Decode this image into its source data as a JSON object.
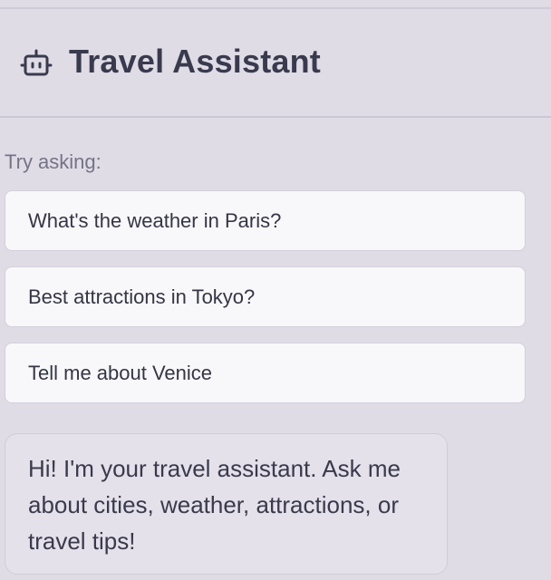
{
  "header": {
    "title": "Travel Assistant",
    "icon": "robot-icon"
  },
  "suggestions": {
    "label": "Try asking:",
    "items": [
      {
        "label": "What's the weather in Paris?"
      },
      {
        "label": "Best attractions in Tokyo?"
      },
      {
        "label": "Tell me about Venice"
      }
    ]
  },
  "messages": [
    {
      "role": "assistant",
      "text": "Hi! I'm your travel assistant. Ask me about cities, weather, attractions, or travel tips!"
    }
  ],
  "colors": {
    "background": "#dfdce6",
    "card": "#f8f8fa",
    "text": "#3a3a4c",
    "muted": "#757386"
  }
}
